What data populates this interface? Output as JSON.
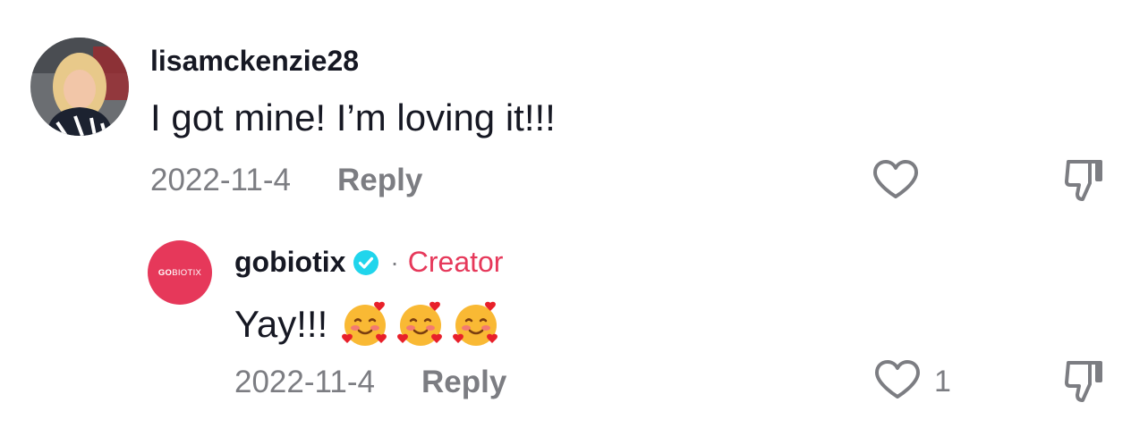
{
  "comments": [
    {
      "username": "lisamckenzie28",
      "text": "I got mine! I’m loving it!!!",
      "date": "2022-11-4",
      "reply_label": "Reply",
      "like_icon": "heart-outline-icon",
      "dislike_icon": "thumbs-down-icon"
    }
  ],
  "reply": {
    "username": "gobiotix",
    "verified_icon": "verified-badge-icon",
    "separator": "·",
    "badge": "Creator",
    "text": "Yay!!!",
    "emojis": [
      "smiling-face-with-hearts",
      "smiling-face-with-hearts",
      "smiling-face-with-hearts"
    ],
    "date": "2022-11-4",
    "reply_label": "Reply",
    "like_count": "1",
    "avatar_logo_bold": "GO",
    "avatar_logo_light": "BIOTIX"
  },
  "colors": {
    "creator_accent": "#e6385a",
    "verified_blue": "#20d5ec",
    "muted_text": "#7c7d82",
    "primary_text": "#161823"
  }
}
